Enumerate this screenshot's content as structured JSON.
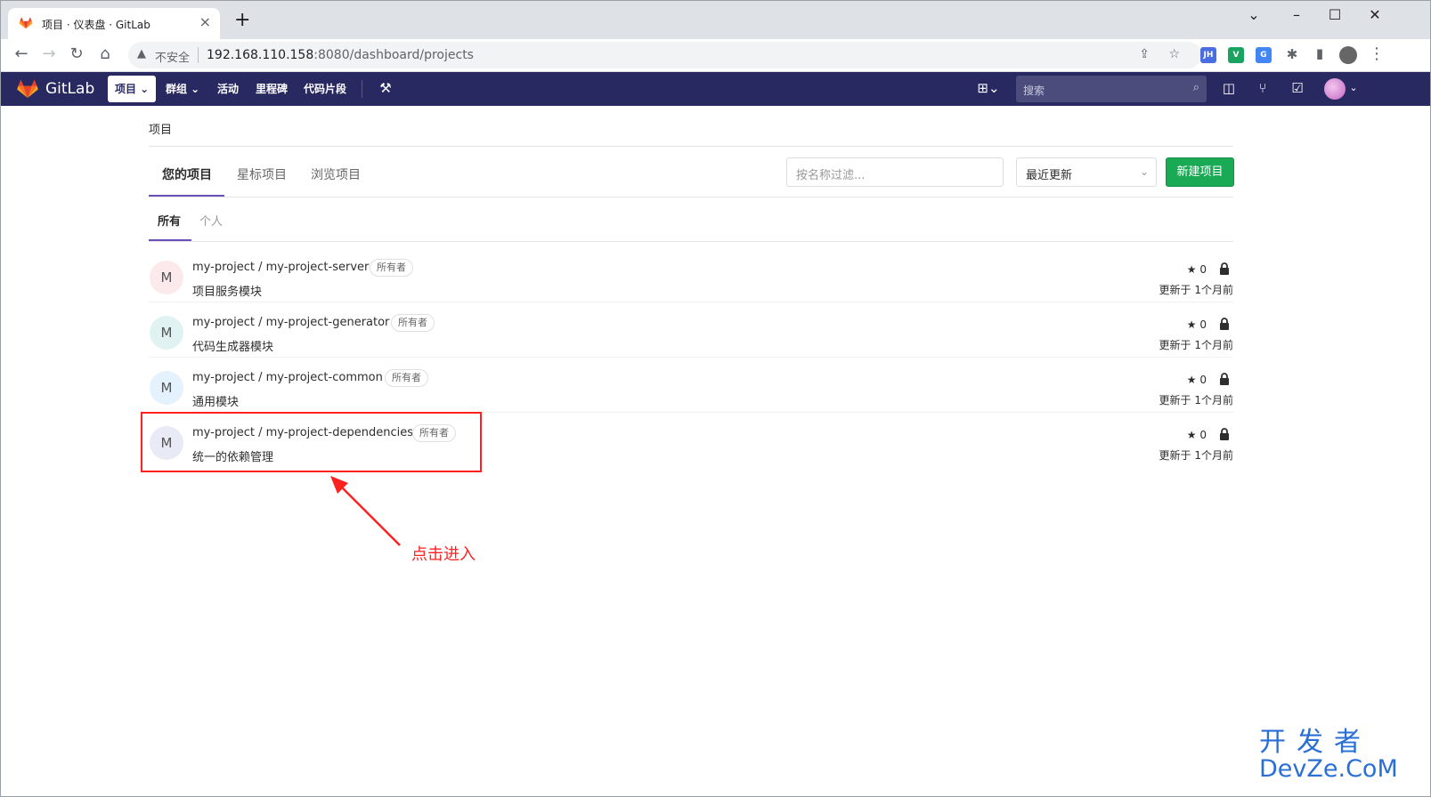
{
  "browser": {
    "tab_title": "项目 · 仪表盘 · GitLab",
    "tab_close": "×",
    "new_tab": "+",
    "window_controls": [
      "⌄",
      "–",
      "☐",
      "✕"
    ],
    "insecure_label": "不安全",
    "url_host": "192.168.110.158",
    "url_rest": ":8080/dashboard/projects",
    "extensions": [
      {
        "name": "JH",
        "color": "#4a6ee0"
      },
      {
        "name": "V",
        "color": "#1aa260"
      },
      {
        "name": "G",
        "color": "#4285f4"
      }
    ]
  },
  "gitlab": {
    "brand": "GitLab",
    "nav": [
      {
        "label": "项目 ⌄",
        "active": true
      },
      {
        "label": "群组 ⌄"
      },
      {
        "label": "活动"
      },
      {
        "label": "里程碑"
      },
      {
        "label": "代码片段"
      }
    ],
    "search_placeholder": "搜索",
    "accent": "#292961"
  },
  "page": {
    "breadcrumb": "项目",
    "tabs": [
      "您的项目",
      "星标项目",
      "浏览项目"
    ],
    "filter_placeholder": "按名称过滤...",
    "sort_selected": "最近更新",
    "new_project": "新建项目",
    "subtabs": [
      "所有",
      "个人"
    ]
  },
  "projects": [
    {
      "initial": "M",
      "name": "my-project / my-project-server",
      "role": "所有者",
      "desc": "项目服务模块",
      "stars": "0",
      "updated": "更新于 1个月前",
      "avatar_color": "#fbe9eb"
    },
    {
      "initial": "M",
      "name": "my-project / my-project-generator",
      "role": "所有者",
      "desc": "代码生成器模块",
      "stars": "0",
      "updated": "更新于 1个月前",
      "avatar_color": "#e0f2f1"
    },
    {
      "initial": "M",
      "name": "my-project / my-project-common",
      "role": "所有者",
      "desc": "通用模块",
      "stars": "0",
      "updated": "更新于 1个月前",
      "avatar_color": "#e3f2fd"
    },
    {
      "initial": "M",
      "name": "my-project / my-project-dependencies",
      "role": "所有者",
      "desc": "统一的依赖管理",
      "stars": "0",
      "updated": "更新于 1个月前",
      "avatar_color": "#e8eaf6"
    }
  ],
  "annotation": {
    "text": "点击进入",
    "color": "#ff2020"
  },
  "watermark": {
    "cn": "开发者",
    "en": "DevZe.CoM"
  }
}
